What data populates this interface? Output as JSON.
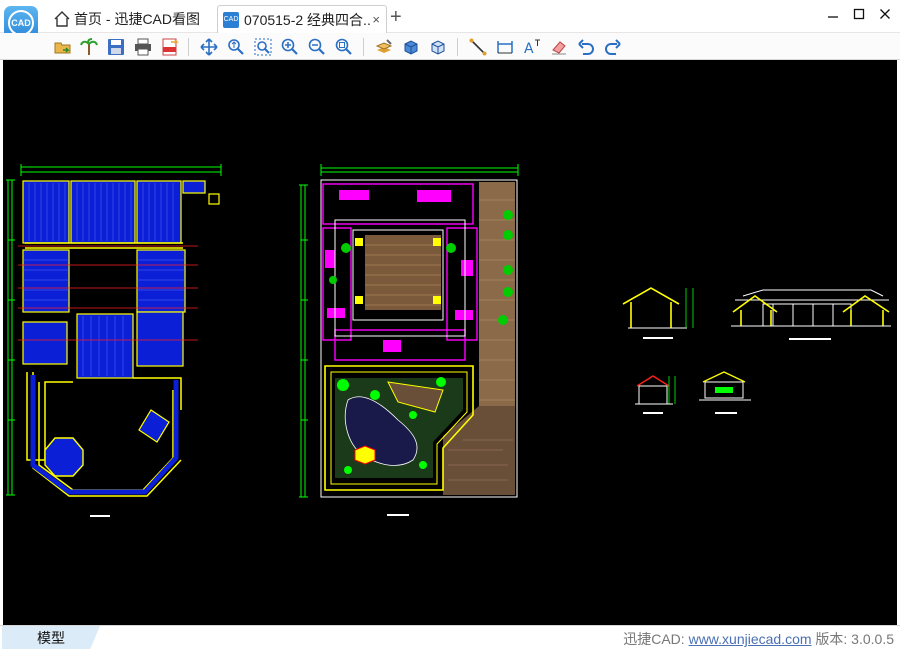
{
  "titlebar": {
    "home_tab_label": "首页 - 迅捷CAD看图",
    "doc_tab_label": "070515-2 经典四合..",
    "doc_tab_close": "×",
    "new_tab": "+",
    "logo_text": "CAD",
    "doc_icon_text": "CAD"
  },
  "toolbar": {
    "icons": [
      "open-file-icon",
      "palm-tree-icon",
      "save-icon",
      "print-icon",
      "export-pdf-icon",
      "pan-icon",
      "zoom-realtime-icon",
      "zoom-window-icon",
      "zoom-in-icon",
      "zoom-out-icon",
      "zoom-extent-icon",
      "layer-icon",
      "3d-view-icon",
      "3d-box-icon",
      "line-measure-icon",
      "dimension-icon",
      "text-icon",
      "eraser-icon",
      "undo-icon",
      "redo-icon"
    ]
  },
  "drawing": {
    "background": "#000000",
    "colors": {
      "blue": "#0a1fd6",
      "yellow": "#ffff00",
      "green": "#00ff00",
      "magenta": "#ff00ff",
      "red": "#ff2020",
      "brown": "#8a6a48",
      "white": "#ffffff"
    }
  },
  "statusbar": {
    "model_tab": "模型",
    "brand_prefix": "迅捷CAD: ",
    "brand_link": "www.xunjiecad.com",
    "version_label": " 版本: 3.0.0.5"
  }
}
